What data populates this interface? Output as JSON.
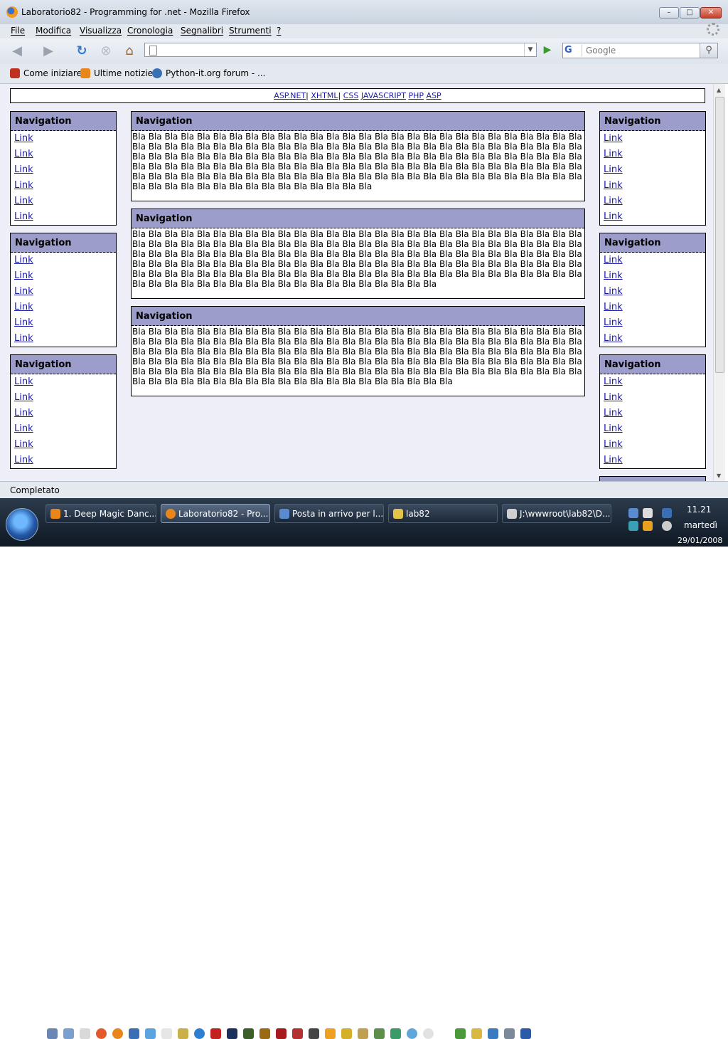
{
  "window": {
    "title": "Laboratorio82 - Programming for .net - Mozilla Firefox",
    "min": "–",
    "max": "□",
    "close": "✕"
  },
  "menu": [
    "File",
    "Modifica",
    "Visualizza",
    "Cronologia",
    "Segnalibri",
    "Strumenti",
    "?"
  ],
  "toolbar": {
    "back_icon": "back-arrow",
    "forward_icon": "forward-arrow",
    "url_value": "",
    "search_placeholder": "Google",
    "search_engine": "G"
  },
  "bookmarks": [
    {
      "label": "Come iniziare",
      "color": "#c0301e"
    },
    {
      "label": "Ultime notizie",
      "color": "#e8861a"
    },
    {
      "label": "Python-it.org forum - ...",
      "color": "#3a6fb5"
    }
  ],
  "page": {
    "topnav": [
      "ASP.NET",
      "XHTML",
      "CSS",
      "JAVASCRIPT",
      "PHP",
      "ASP"
    ],
    "separator": "|",
    "left_boxes": [
      {
        "title": "Navigation",
        "links": [
          "Link",
          "Link",
          "Link",
          "Link",
          "Link",
          "Link"
        ]
      },
      {
        "title": "Navigation",
        "links": [
          "Link",
          "Link",
          "Link",
          "Link",
          "Link",
          "Link"
        ]
      },
      {
        "title": "Navigation",
        "links": [
          "Link",
          "Link",
          "Link",
          "Link",
          "Link",
          "Link"
        ]
      }
    ],
    "right_boxes": [
      {
        "title": "Navigation",
        "links": [
          "Link",
          "Link",
          "Link",
          "Link",
          "Link",
          "Link"
        ]
      },
      {
        "title": "Navigation",
        "links": [
          "Link",
          "Link",
          "Link",
          "Link",
          "Link",
          "Link"
        ]
      },
      {
        "title": "Navigation",
        "links": [
          "Link",
          "Link",
          "Link",
          "Link",
          "Link",
          "Link"
        ]
      }
    ],
    "center_boxes": [
      {
        "title": "Navigation",
        "text": "Bla Bla Bla Bla Bla Bla Bla Bla Bla Bla Bla Bla Bla Bla Bla Bla Bla Bla Bla Bla Bla Bla Bla Bla Bla Bla Bla Bla Bla Bla Bla Bla Bla Bla Bla Bla Bla Bla Bla Bla Bla Bla Bla Bla Bla Bla Bla Bla Bla Bla Bla Bla Bla Bla Bla Bla Bla Bla Bla Bla Bla Bla Bla Bla Bla Bla Bla Bla Bla Bla Bla Bla Bla Bla Bla Bla Bla Bla Bla Bla Bla Bla Bla Bla Bla Bla Bla Bla Bla Bla Bla Bla Bla Bla Bla Bla Bla Bla Bla Bla Bla Bla Bla Bla Bla Bla Bla Bla Bla Bla Bla Bla Bla Bla Bla Bla Bla Bla Bla Bla Bla Bla Bla Bla Bla Bla Bla Bla Bla Bla Bla Bla Bla Bla Bla Bla Bla Bla Bla Bla Bla Bla Bla Bla Bla Bla Bla Bla Bla Bla Bla Bla Bla Bla Bla"
      },
      {
        "title": "Navigation",
        "text": "Bla Bla Bla Bla Bla Bla Bla Bla Bla Bla Bla Bla Bla Bla Bla Bla Bla Bla Bla Bla Bla Bla Bla Bla Bla Bla Bla Bla Bla Bla Bla Bla Bla Bla Bla Bla Bla Bla Bla Bla Bla Bla Bla Bla Bla Bla Bla Bla Bla Bla Bla Bla Bla Bla Bla Bla Bla Bla Bla Bla Bla Bla Bla Bla Bla Bla Bla Bla Bla Bla Bla Bla Bla Bla Bla Bla Bla Bla Bla Bla Bla Bla Bla Bla Bla Bla Bla Bla Bla Bla Bla Bla Bla Bla Bla Bla Bla Bla Bla Bla Bla Bla Bla Bla Bla Bla Bla Bla Bla Bla Bla Bla Bla Bla Bla Bla Bla Bla Bla Bla Bla Bla Bla Bla Bla Bla Bla Bla Bla Bla Bla Bla Bla Bla Bla Bla Bla Bla Bla Bla Bla Bla Bla Bla Bla Bla Bla Bla Bla Bla Bla Bla Bla Bla Bla Bla Bla Bla Bla"
      },
      {
        "title": "Navigation",
        "text": "Bla Bla Bla Bla Bla Bla Bla Bla Bla Bla Bla Bla Bla Bla Bla Bla Bla Bla Bla Bla Bla Bla Bla Bla Bla Bla Bla Bla Bla Bla Bla Bla Bla Bla Bla Bla Bla Bla Bla Bla Bla Bla Bla Bla Bla Bla Bla Bla Bla Bla Bla Bla Bla Bla Bla Bla Bla Bla Bla Bla Bla Bla Bla Bla Bla Bla Bla Bla Bla Bla Bla Bla Bla Bla Bla Bla Bla Bla Bla Bla Bla Bla Bla Bla Bla Bla Bla Bla Bla Bla Bla Bla Bla Bla Bla Bla Bla Bla Bla Bla Bla Bla Bla Bla Bla Bla Bla Bla Bla Bla Bla Bla Bla Bla Bla Bla Bla Bla Bla Bla Bla Bla Bla Bla Bla Bla Bla Bla Bla Bla Bla Bla Bla Bla Bla Bla Bla Bla Bla Bla Bla Bla Bla Bla Bla Bla Bla Bla Bla Bla Bla Bla Bla Bla Bla Bla Bla Bla Bla Bla"
      }
    ]
  },
  "status": {
    "text": "Completato"
  },
  "taskbar": {
    "tasks": [
      {
        "label": "1. Deep Magic Danc...",
        "active": false,
        "color": "#e8861a"
      },
      {
        "label": "Laboratorio82 - Pro...",
        "active": true,
        "color": "#e8861a"
      },
      {
        "label": "Posta in arrivo per l...",
        "active": false,
        "color": "#5a8ad0"
      },
      {
        "label": "lab82",
        "active": false,
        "color": "#e3c34a"
      },
      {
        "label": "J:\\wwwroot\\lab82\\D...",
        "active": false,
        "color": "#cfcfcf"
      }
    ],
    "clock": {
      "time": "11.21",
      "day": "martedì",
      "date": "29/01/2008"
    }
  }
}
